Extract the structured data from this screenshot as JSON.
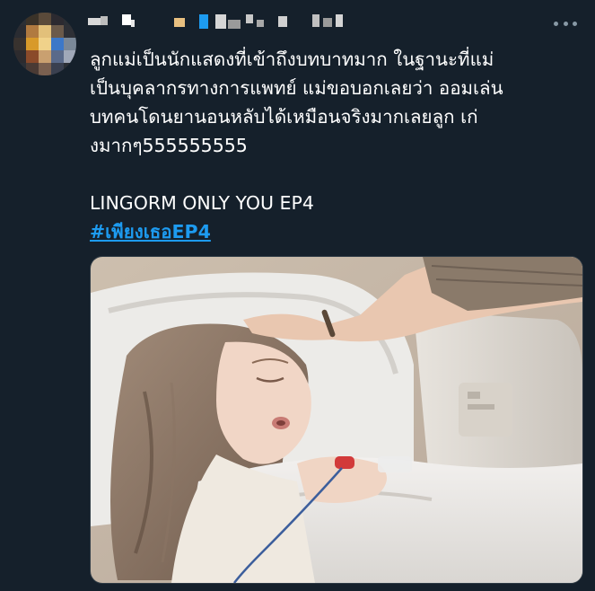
{
  "tweet": {
    "text_lines": [
      "ลูกแม่เป็นนักแสดงที่เข้าถึงบทบาทมาก ในฐานะที่แม่",
      "เป็นบุคลากรทางการแพทย์ แม่ขอบอกเลยว่า ออมเล่น",
      "บทคนโดนยานอนหลับได้เหมือนจริงมากเลยลูก เก่",
      "งมากๆ555555555"
    ],
    "title_line": "LINGORM ONLY YOU EP4",
    "hashtag": "#เพียงเธอEP4",
    "more_icon": "more-horizontal-icon",
    "colors": {
      "background": "#15202b",
      "text": "#ffffff",
      "link": "#1d9bf0",
      "muted": "#8899a6"
    }
  }
}
